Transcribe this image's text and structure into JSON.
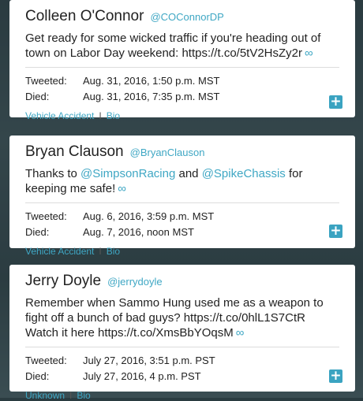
{
  "cards": [
    {
      "name": "Colleen O'Connor",
      "handle": "@COConnorDP",
      "tweet_text": "Get ready for some wicked traffic if you're heading out of town on Labor Day weekend: https://t.co/5tV2HsZy2r",
      "tweeted_label": "Tweeted:",
      "tweeted_value": "Aug. 31, 2016, 1:50 p.m. MST",
      "died_label": "Died:",
      "died_value": "Aug. 31, 2016, 7:35 p.m. MST",
      "cause": "Vehicle Accident",
      "bio": "Bio"
    },
    {
      "name": "Bryan Clauson",
      "handle": "@BryanClauson",
      "tweet_parts": [
        "Thanks to ",
        "@SimpsonRacing",
        " and ",
        "@SpikeChassis",
        " for keeping me safe!"
      ],
      "tweeted_label": "Tweeted:",
      "tweeted_value": "Aug. 6, 2016, 3:59 p.m. MST",
      "died_label": "Died:",
      "died_value": "Aug. 7, 2016, noon MST",
      "cause": "Vehicle Accident",
      "bio": "Bio"
    },
    {
      "name": "Jerry Doyle",
      "handle": "@jerrydoyle",
      "tweet_text": "Remember when Sammo Hung used me as a weapon to fight off a bunch of bad guys? https://t.co/0hlL1S7CtR Watch it here https://t.co/XmsBbYOqsM",
      "tweeted_label": "Tweeted:",
      "tweeted_value": "July 27, 2016, 3:51 p.m. PST",
      "died_label": "Died:",
      "died_value": "July 27, 2016, 4 p.m. PST",
      "cause": "Unknown",
      "bio": "Bio"
    }
  ],
  "icons": {
    "link_icon": "∞",
    "expand_icon": "+",
    "separator": "I"
  },
  "colors": {
    "accent": "#3fa7c4",
    "card": "#ffffff",
    "background": "#2e4045"
  }
}
